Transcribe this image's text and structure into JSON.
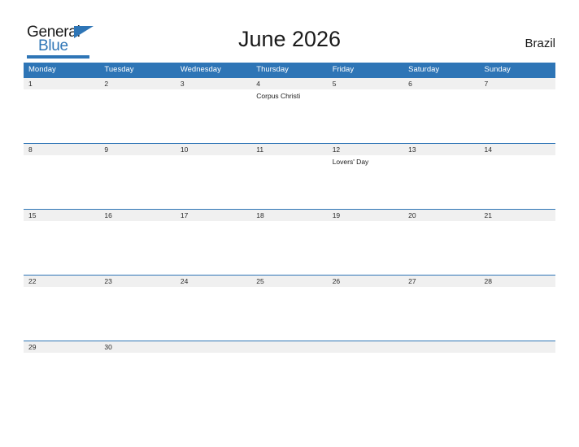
{
  "brand": {
    "name_line1": "General",
    "name_line2": "Blue",
    "accent_color": "#2E75B6"
  },
  "header": {
    "title": "June 2026",
    "country": "Brazil"
  },
  "calendar": {
    "weekdays": [
      "Monday",
      "Tuesday",
      "Wednesday",
      "Thursday",
      "Friday",
      "Saturday",
      "Sunday"
    ],
    "weeks": [
      {
        "days": [
          {
            "num": "1",
            "event": ""
          },
          {
            "num": "2",
            "event": ""
          },
          {
            "num": "3",
            "event": ""
          },
          {
            "num": "4",
            "event": "Corpus Christi"
          },
          {
            "num": "5",
            "event": ""
          },
          {
            "num": "6",
            "event": ""
          },
          {
            "num": "7",
            "event": ""
          }
        ]
      },
      {
        "days": [
          {
            "num": "8",
            "event": ""
          },
          {
            "num": "9",
            "event": ""
          },
          {
            "num": "10",
            "event": ""
          },
          {
            "num": "11",
            "event": ""
          },
          {
            "num": "12",
            "event": "Lovers' Day"
          },
          {
            "num": "13",
            "event": ""
          },
          {
            "num": "14",
            "event": ""
          }
        ]
      },
      {
        "days": [
          {
            "num": "15",
            "event": ""
          },
          {
            "num": "16",
            "event": ""
          },
          {
            "num": "17",
            "event": ""
          },
          {
            "num": "18",
            "event": ""
          },
          {
            "num": "19",
            "event": ""
          },
          {
            "num": "20",
            "event": ""
          },
          {
            "num": "21",
            "event": ""
          }
        ]
      },
      {
        "days": [
          {
            "num": "22",
            "event": ""
          },
          {
            "num": "23",
            "event": ""
          },
          {
            "num": "24",
            "event": ""
          },
          {
            "num": "25",
            "event": ""
          },
          {
            "num": "26",
            "event": ""
          },
          {
            "num": "27",
            "event": ""
          },
          {
            "num": "28",
            "event": ""
          }
        ]
      },
      {
        "days": [
          {
            "num": "29",
            "event": ""
          },
          {
            "num": "30",
            "event": ""
          },
          {
            "num": "",
            "event": ""
          },
          {
            "num": "",
            "event": ""
          },
          {
            "num": "",
            "event": ""
          },
          {
            "num": "",
            "event": ""
          },
          {
            "num": "",
            "event": ""
          }
        ]
      }
    ]
  }
}
